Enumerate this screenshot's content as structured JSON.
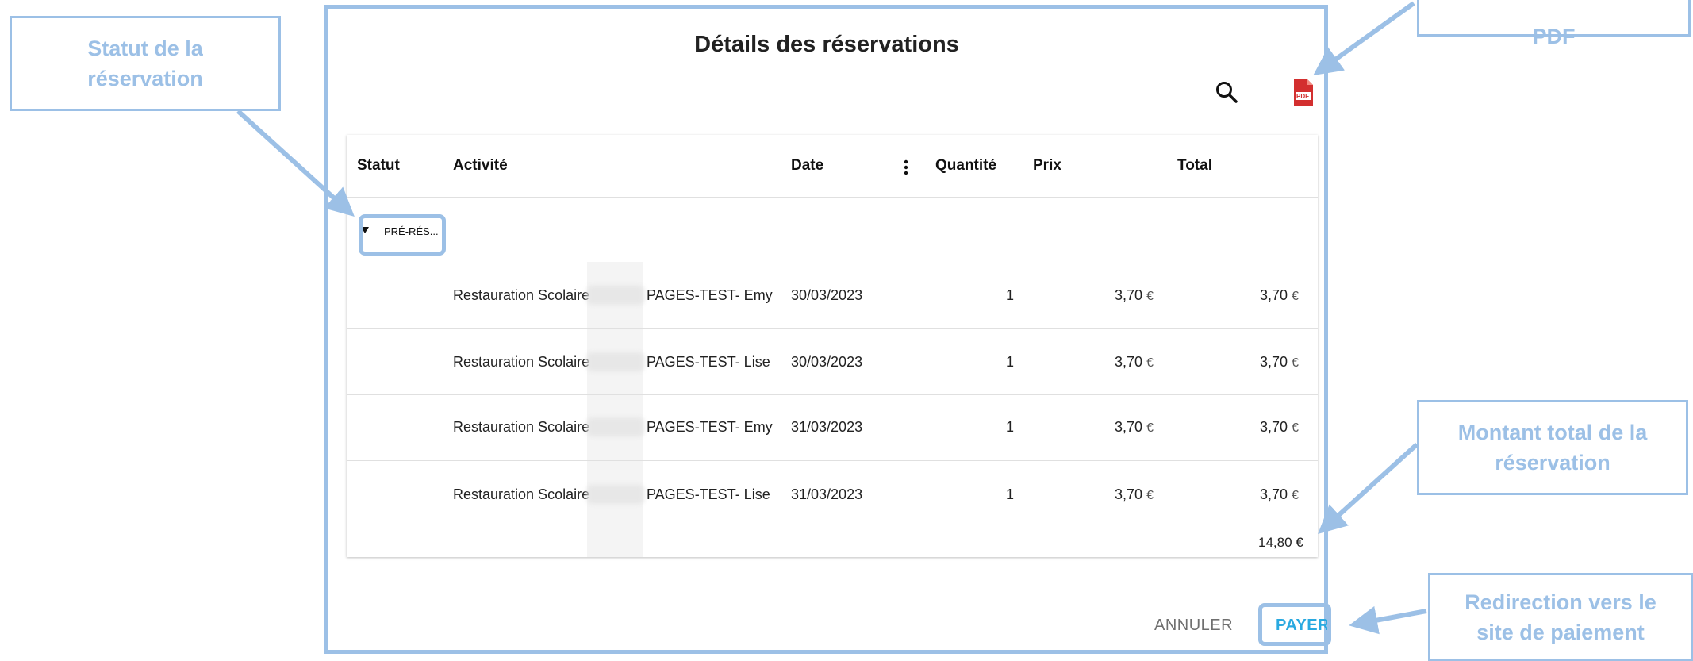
{
  "dialog": {
    "title": "Détails des réservations",
    "search_icon": "search-icon",
    "pdf_icon": "pdf-icon",
    "pdf_label": "PDF",
    "columns": [
      "Statut",
      "Activité",
      "Date",
      "Quantité",
      "Prix",
      "Total"
    ],
    "group": {
      "status_label": "PRÉ-RÉS..."
    },
    "rows": [
      {
        "activity": "Restauration Scolaire",
        "child": "PAGES-TEST- Emy",
        "date": "30/03/2023",
        "quantity": "1",
        "price": "3,70",
        "total": "3,70"
      },
      {
        "activity": "Restauration Scolaire",
        "child": "PAGES-TEST- Lise",
        "date": "30/03/2023",
        "quantity": "1",
        "price": "3,70",
        "total": "3,70"
      },
      {
        "activity": "Restauration Scolaire",
        "child": "PAGES-TEST- Emy",
        "date": "31/03/2023",
        "quantity": "1",
        "price": "3,70",
        "total": "3,70"
      },
      {
        "activity": "Restauration Scolaire",
        "child": "PAGES-TEST- Lise",
        "date": "31/03/2023",
        "quantity": "1",
        "price": "3,70",
        "total": "3,70"
      }
    ],
    "currency": "€",
    "grand_total": "14,80 €",
    "cancel_label": "ANNULER",
    "pay_label": "PAYER"
  },
  "annotations": {
    "status": "Statut de la réservation",
    "total": "Montant total de la réservation",
    "payment": "Redirection vers le site de paiement",
    "pdf_partial": "PDF"
  },
  "colors": {
    "annotation": "#9cc0e6",
    "pay_button": "#29a9e0",
    "pdf_icon": "#d32f2f"
  }
}
